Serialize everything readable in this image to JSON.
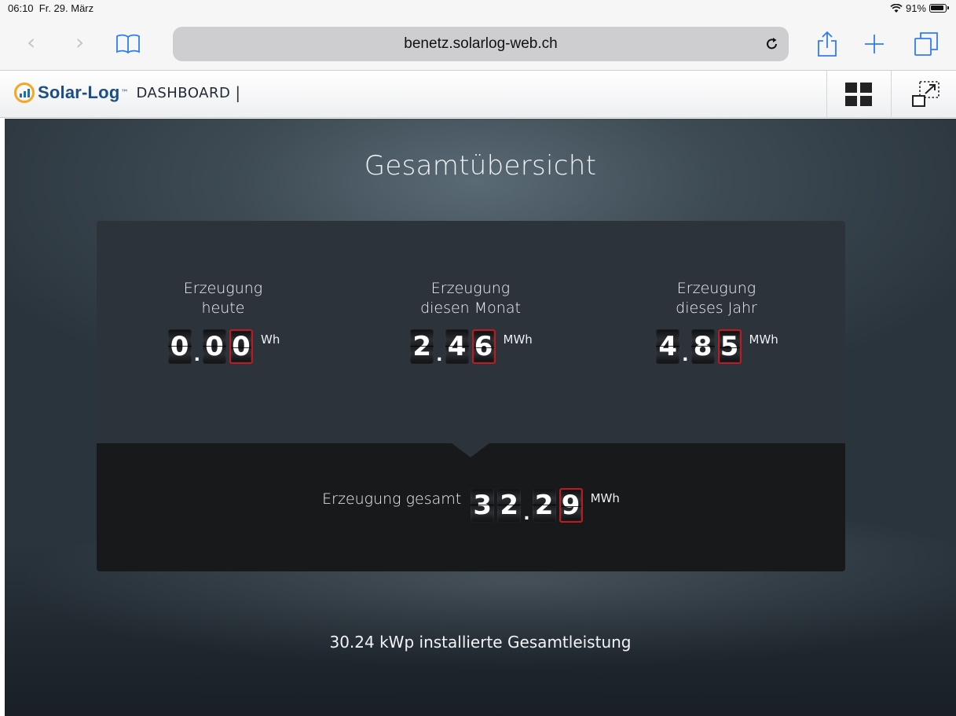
{
  "status_bar": {
    "time": "06:10",
    "date": "Fr. 29. März",
    "battery": "91%"
  },
  "browser": {
    "url": "benetz.solarlog-web.ch",
    "icons": [
      "back-icon",
      "forward-icon",
      "bookmarks-icon",
      "reload-icon",
      "share-icon",
      "new-tab-icon",
      "tabs-icon"
    ]
  },
  "app": {
    "logo_text": "Solar-Log",
    "logo_tm": "™",
    "section": "DASHBOARD",
    "separator": "|"
  },
  "page": {
    "title": "Gesamtübersicht",
    "stats": [
      {
        "label_line1": "Erzeugung",
        "label_line2": "heute",
        "int": "0",
        "dec1": "0",
        "dec2": "0",
        "unit": "Wh"
      },
      {
        "label_line1": "Erzeugung",
        "label_line2": "diesen Monat",
        "int": "2",
        "dec1": "4",
        "dec2": "6",
        "unit": "MWh"
      },
      {
        "label_line1": "Erzeugung",
        "label_line2": "dieses Jahr",
        "int": "4",
        "dec1": "8",
        "dec2": "5",
        "unit": "MWh"
      }
    ],
    "total": {
      "label": "Erzeugung gesamt",
      "d1": "3",
      "d2": "2",
      "d3": "2",
      "d4": "9",
      "unit": "MWh"
    },
    "footer": "30.24 kWp installierte Gesamtleistung"
  },
  "colors": {
    "accent_red": "#c0191f",
    "logo_orange": "#f5a623",
    "logo_blue": "#1c4e86"
  }
}
